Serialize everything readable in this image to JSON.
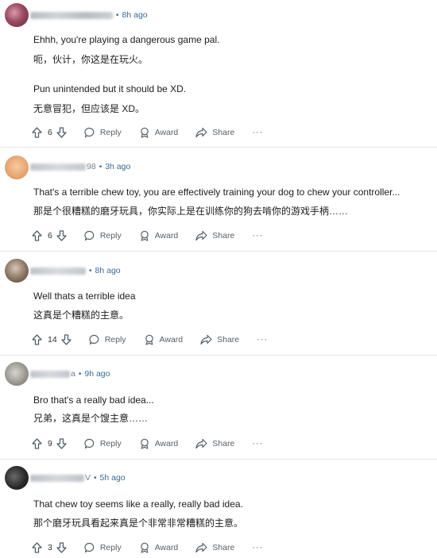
{
  "actions": {
    "reply_label": "Reply",
    "award_label": "Award",
    "share_label": "Share",
    "more_label": "···"
  },
  "comments": [
    {
      "username_visible": "",
      "time": "8h ago",
      "lines": [
        "Ehhh, you're playing a dangerous game pal.",
        "呃，伙计，你这是在玩火。",
        "Pun unintended but it should be XD.",
        "无意冒犯，但应该是 XD。"
      ],
      "votes": "6"
    },
    {
      "username_visible": "98",
      "time": "3h ago",
      "lines": [
        "That's a terrible chew toy, you are effectively training your dog to chew your controller...",
        "那是个很糟糕的磨牙玩具，你实际上是在训练你的狗去啃你的游戏手柄……"
      ],
      "votes": "6"
    },
    {
      "username_visible": "",
      "time": "8h ago",
      "lines": [
        "Well thats a terrible idea",
        "这真是个糟糕的主意。"
      ],
      "votes": "14"
    },
    {
      "username_visible": "a",
      "time": "9h ago",
      "lines": [
        "Bro that's a really bad idea...",
        "兄弟，这真是个馊主意……"
      ],
      "votes": "9"
    },
    {
      "username_visible": "V",
      "time": "5h ago",
      "lines": [
        "That chew toy seems like a really, really bad idea.",
        "那个磨牙玩具看起来真是个非常非常糟糕的主意。"
      ],
      "votes": "3"
    }
  ],
  "icons": {
    "upvote": "arrow-up-icon",
    "downvote": "arrow-down-icon",
    "reply": "speech-bubble-icon",
    "award": "award-icon",
    "share": "share-arrow-icon"
  },
  "colors": {
    "timestamp": "#3a6b96",
    "text": "#1c1c1c",
    "action": "#55606a"
  }
}
